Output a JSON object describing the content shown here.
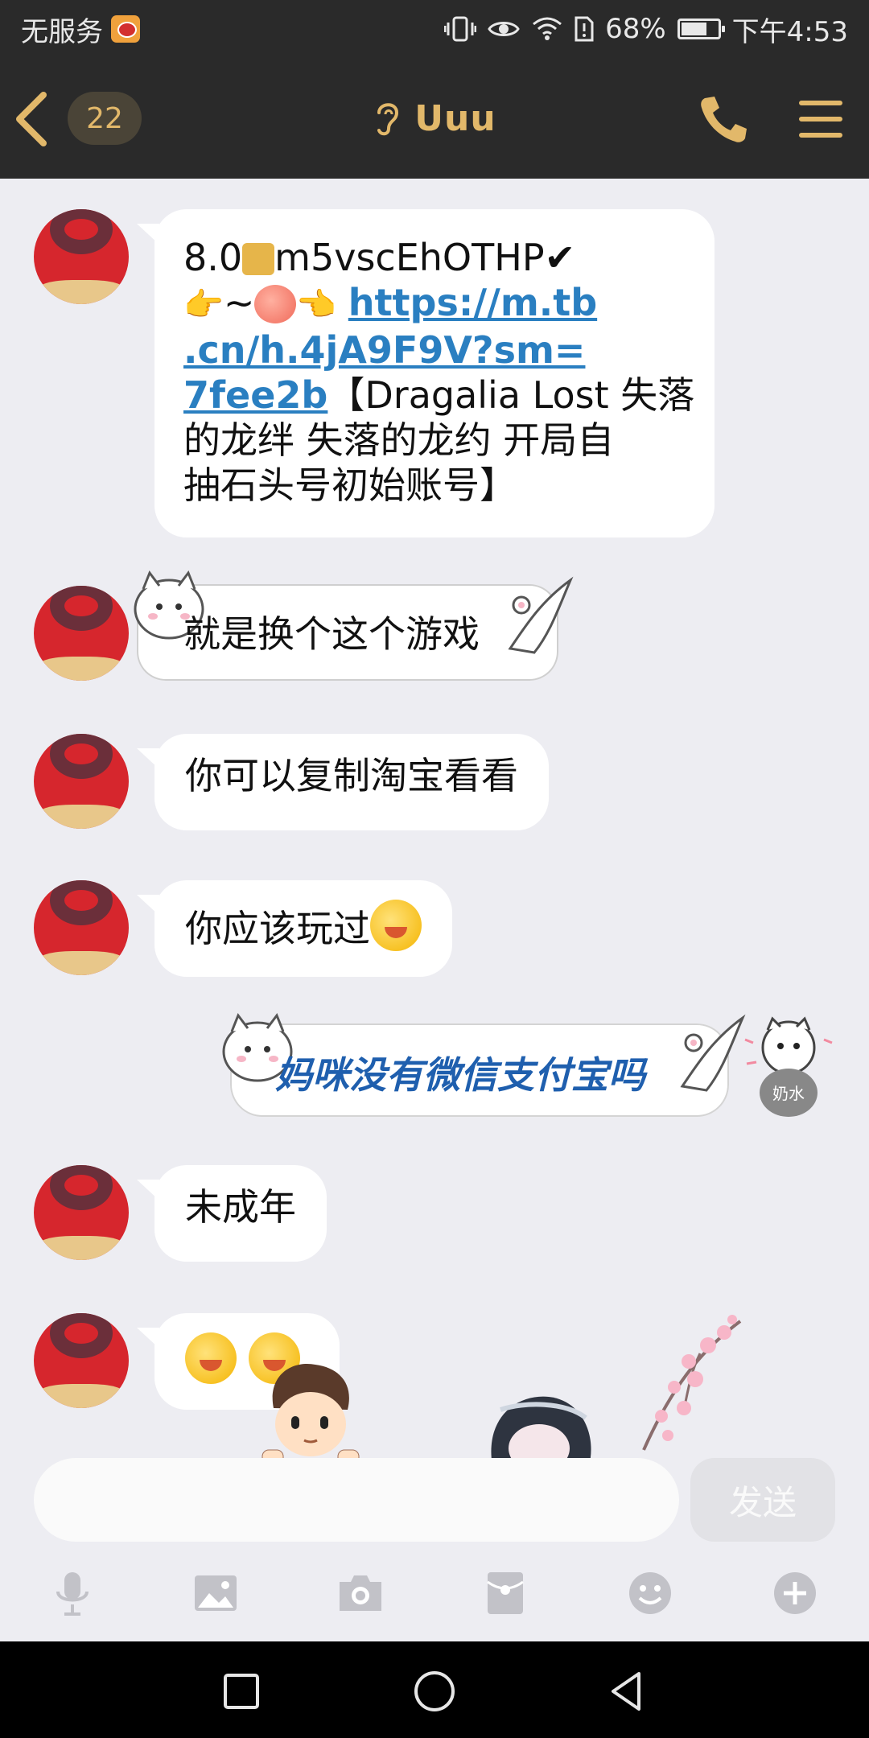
{
  "status_bar": {
    "carrier": "无服务",
    "battery": "68%",
    "time": "下午4:53"
  },
  "header": {
    "unread_count": "22",
    "title": "Uuu"
  },
  "messages": {
    "m1": {
      "line1_prefix": "8.0",
      "line1_code": "m5vscEhOTHP",
      "line1_check": "✔",
      "line2_mid": "~",
      "link_part1": "https://m.tb",
      "link_part2": ".cn/h.4jA9F9V?sm=",
      "link_part3": "7fee2b",
      "line4_rest": "【Dragalia Lost 失落",
      "line5": "的龙绊 失落的龙约 开局自",
      "line6": "抽石头号初始账号】"
    },
    "m2": "就是换个这个游戏",
    "m3": "你可以复制淘宝看看",
    "m4": "你应该玩过",
    "m5_self": "妈咪没有微信支付宝吗",
    "m5_sticker_text": "奶水",
    "m6": "未成年",
    "m7": "emoji-x2"
  },
  "input": {
    "placeholder": "",
    "send_label": "发送"
  },
  "icons": {
    "accent": "#e2b86a",
    "toolbar": [
      "microphone-icon",
      "image-icon",
      "camera-icon",
      "red-packet-icon",
      "emoji-icon",
      "plus-icon"
    ]
  }
}
